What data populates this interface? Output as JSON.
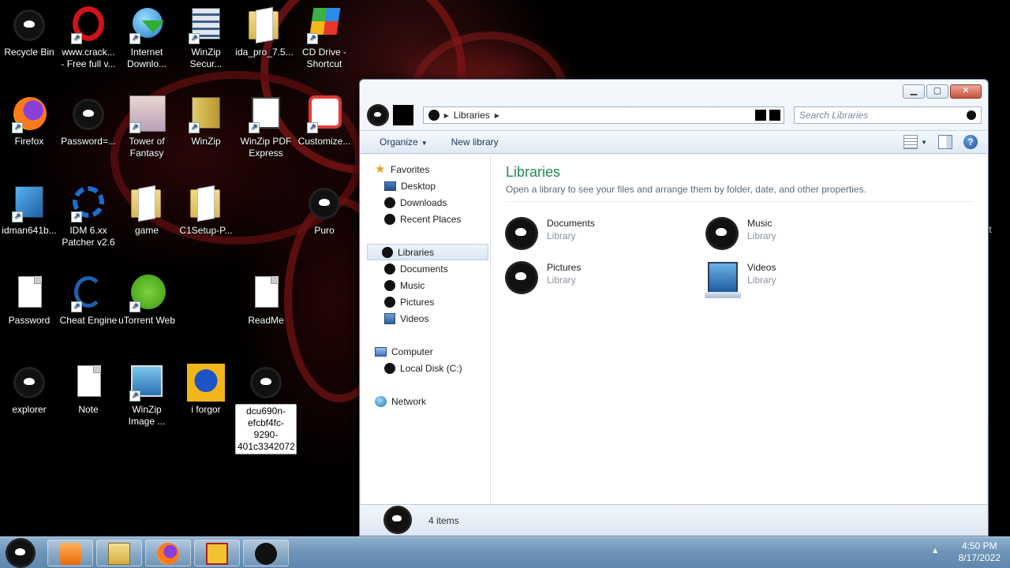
{
  "desktop": {
    "icons": [
      {
        "label": "Recycle Bin"
      },
      {
        "label": "www.crack... - Free full v..."
      },
      {
        "label": "Internet Downlo..."
      },
      {
        "label": "WinZip Secur..."
      },
      {
        "label": "ida_pro_7.5..."
      },
      {
        "label": "CD Drive - Shortcut"
      },
      {
        "label": "Firefox"
      },
      {
        "label": "Password=..."
      },
      {
        "label": "Tower of Fantasy"
      },
      {
        "label": "WinZip"
      },
      {
        "label": "WinZip PDF Express"
      },
      {
        "label": "Customize..."
      },
      {
        "label": "idman641b..."
      },
      {
        "label": "IDM 6.xx Patcher v2.6"
      },
      {
        "label": "game"
      },
      {
        "label": "C1Setup-P..."
      },
      {
        "label": "Puro"
      },
      {
        "label": "Password"
      },
      {
        "label": "Cheat Engine"
      },
      {
        "label": "uTorrent Web"
      },
      {
        "label": "ReadMe"
      },
      {
        "label": "explorer"
      },
      {
        "label": "Note"
      },
      {
        "label": "WinZip Image ..."
      },
      {
        "label": "i forgor"
      },
      {
        "label": "dcu690n-efcbf4fc-9290-401c3342072"
      }
    ],
    "edge_label": "ft"
  },
  "window": {
    "address": {
      "crumb": "Libraries"
    },
    "search": {
      "placeholder": "Search Libraries"
    },
    "toolbar": {
      "organize": "Organize",
      "new_library": "New library",
      "help": "?"
    },
    "nav": {
      "favorites": "Favorites",
      "desktop": "Desktop",
      "downloads": "Downloads",
      "recent": "Recent Places",
      "libraries": "Libraries",
      "documents": "Documents",
      "music": "Music",
      "pictures": "Pictures",
      "videos": "Videos",
      "computer": "Computer",
      "local_disk": "Local Disk (C:)",
      "network": "Network"
    },
    "content": {
      "title": "Libraries",
      "subtitle": "Open a library to see your files and arrange them by folder, date, and other properties.",
      "libraries": [
        {
          "name": "Documents",
          "kind": "Library"
        },
        {
          "name": "Music",
          "kind": "Library"
        },
        {
          "name": "Pictures",
          "kind": "Library"
        },
        {
          "name": "Videos",
          "kind": "Library"
        }
      ]
    },
    "details": {
      "count": "4 items"
    }
  },
  "taskbar": {
    "clock": {
      "time": "4:50 PM",
      "date": "8/17/2022"
    },
    "apps": [
      "media-player-icon",
      "file-explorer-icon",
      "firefox-icon",
      "rh-icon",
      "explorer-ghost-icon"
    ]
  }
}
